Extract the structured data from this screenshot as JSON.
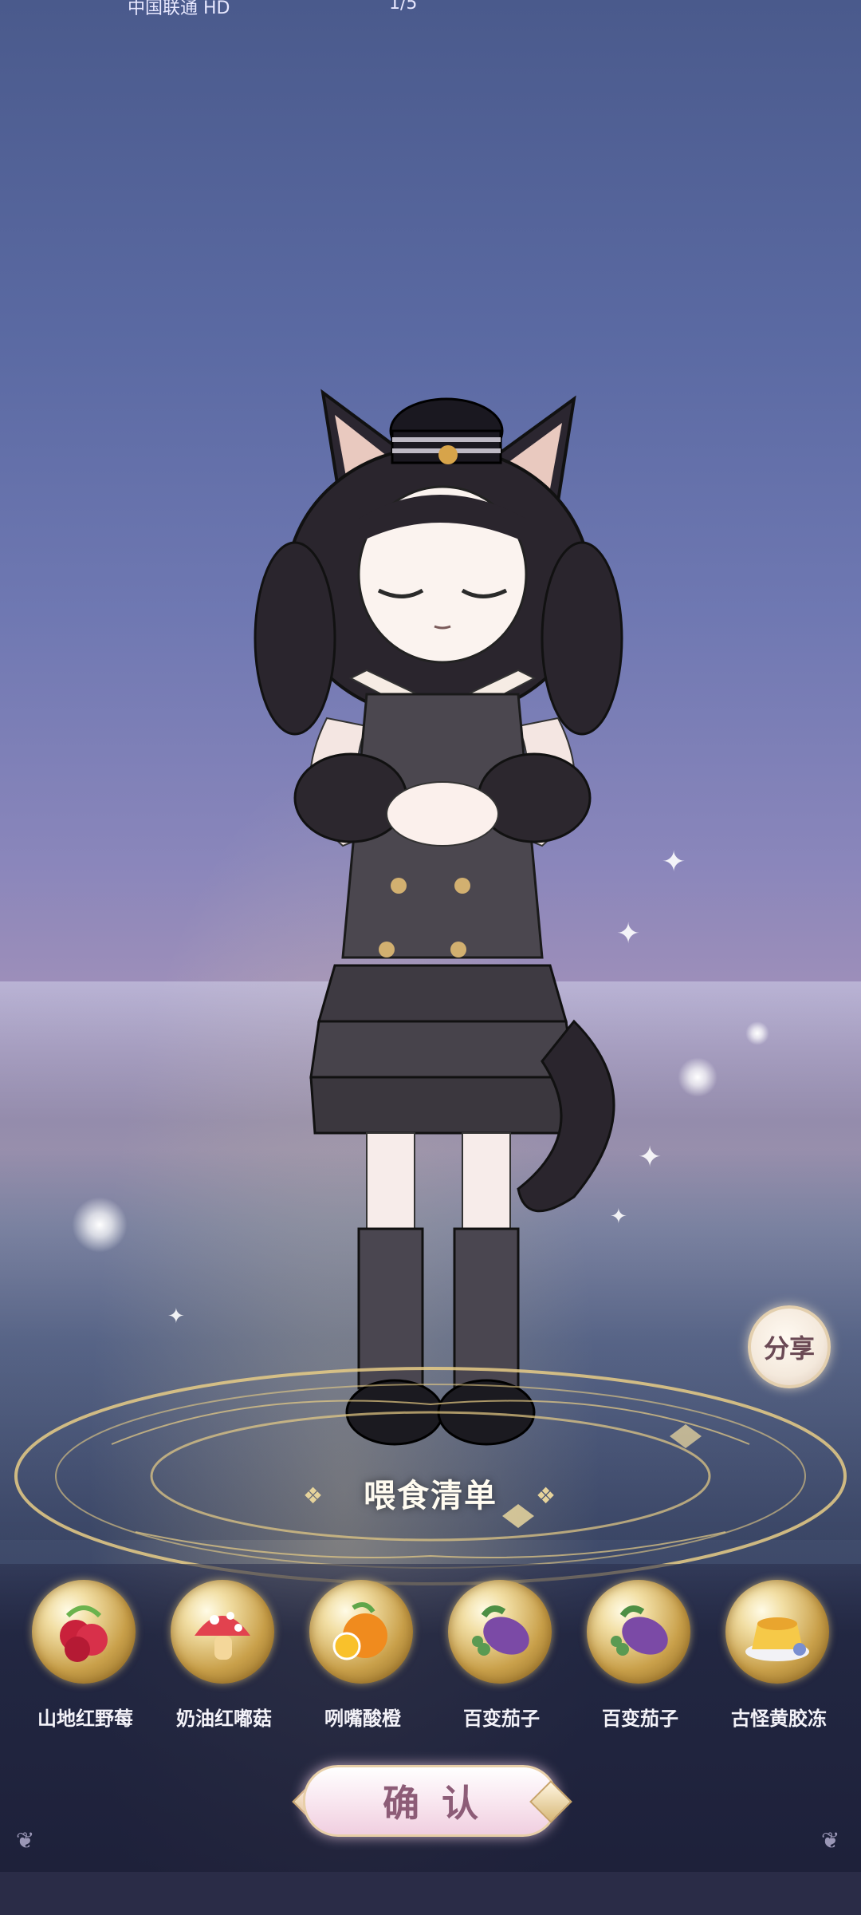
{
  "status_bar": {
    "carrier": "中国联通 HD",
    "center": "1/5"
  },
  "share": {
    "label": "分享"
  },
  "feeding": {
    "title": "喂食清单",
    "items": [
      {
        "name": "山地红野莓",
        "icon": "raspberry-icon"
      },
      {
        "name": "奶油红嘟菇",
        "icon": "mushroom-icon"
      },
      {
        "name": "咧嘴酸橙",
        "icon": "orange-icon"
      },
      {
        "name": "百变茄子",
        "icon": "eggplant-icon"
      },
      {
        "name": "百变茄子",
        "icon": "eggplant-icon"
      },
      {
        "name": "古怪黄胶冻",
        "icon": "pudding-icon"
      }
    ]
  },
  "confirm": {
    "label": "确认"
  },
  "colors": {
    "accent": "#e8cfa8",
    "panel": "#1e2240",
    "button_text": "#8d5c77"
  }
}
